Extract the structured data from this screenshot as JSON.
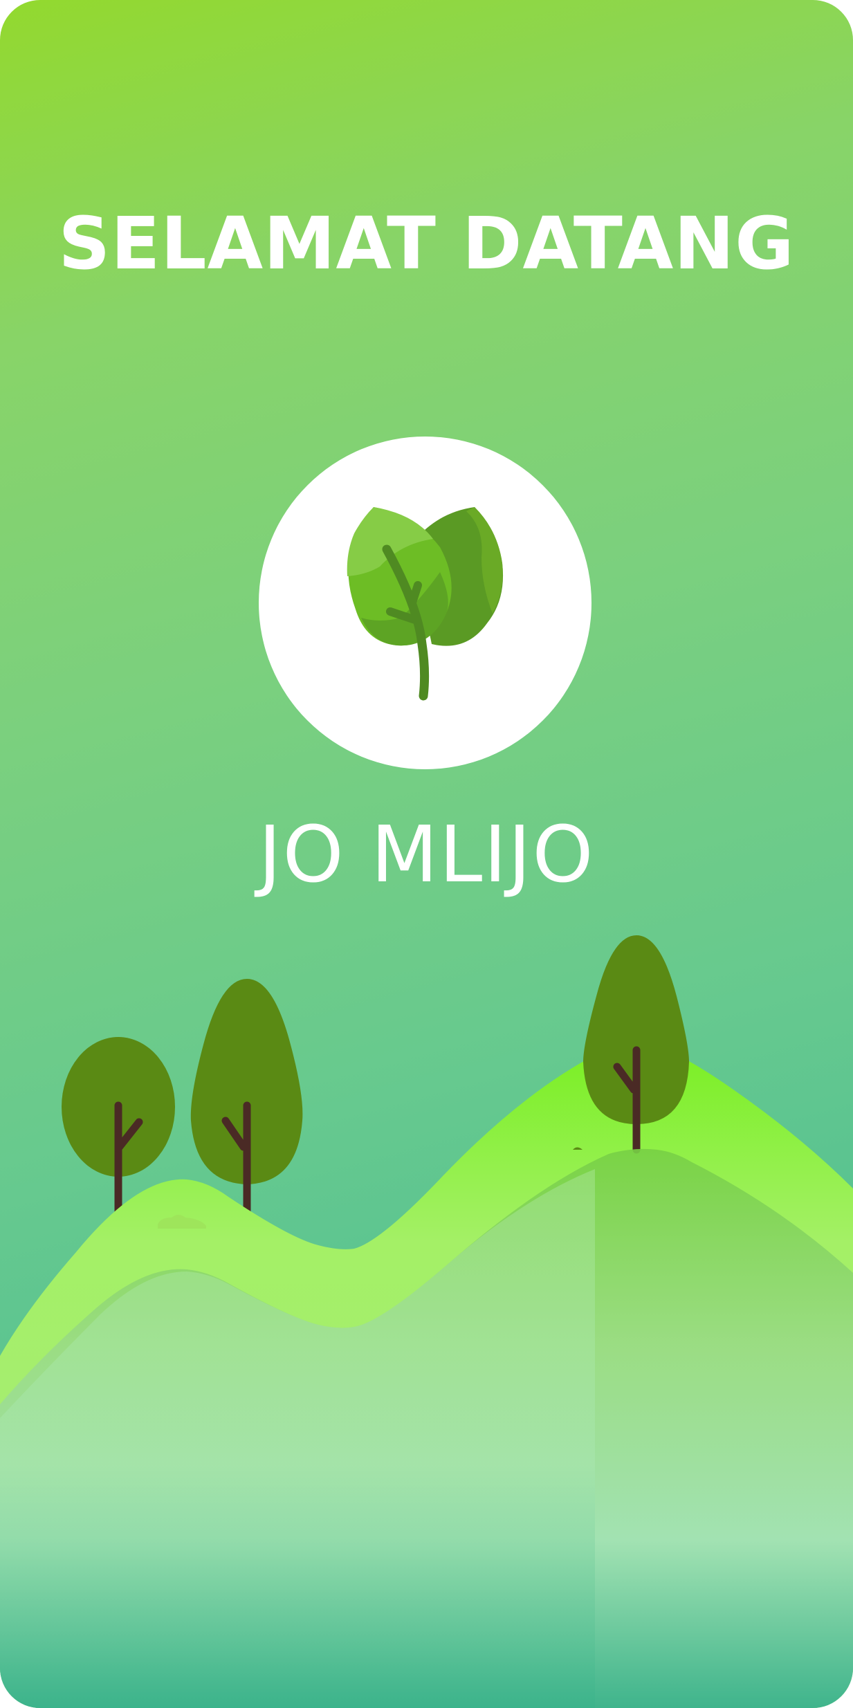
{
  "welcome": {
    "title": "SELAMAT DATANG"
  },
  "logo": {
    "icon": "leaf-icon"
  },
  "app": {
    "name": "JO MLIJO"
  },
  "illustration": {
    "icon": "landscape-trees-hills"
  },
  "colors": {
    "gradient_top": "#93d92e",
    "gradient_bottom": "#3fb68e",
    "tree_foliage": "#5a8a14",
    "tree_trunk": "#4a2a25",
    "hill_bright": "#9fef60",
    "text": "#ffffff"
  }
}
